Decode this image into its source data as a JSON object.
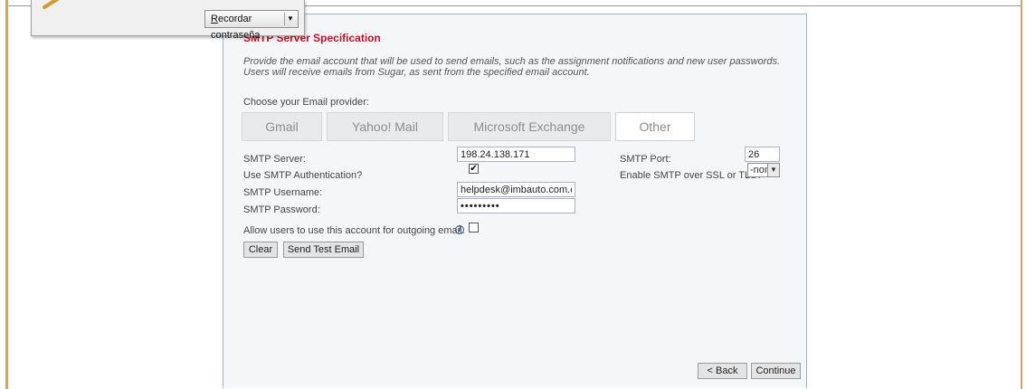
{
  "popup": {
    "remember_button": "Recordar contraseña"
  },
  "smtp": {
    "title": "SMTP Server Specification",
    "description": "Provide the email account that will be used to send emails, such as the assignment notifications and new user passwords. Users will receive emails from Sugar, as sent from the specified email account.",
    "choose_provider": "Choose your Email provider:",
    "providers": [
      {
        "label": "Gmail",
        "selected": false
      },
      {
        "label": "Yahoo! Mail",
        "selected": false
      },
      {
        "label": "Microsoft Exchange",
        "selected": false
      },
      {
        "label": "Other",
        "selected": true
      }
    ],
    "server_label": "SMTP Server:",
    "server_value": "198.24.138.171",
    "port_label": "SMTP Port:",
    "port_value": "26",
    "auth_label": "Use SMTP Authentication?",
    "auth_checked": true,
    "ssl_label": "Enable SMTP over SSL or TLS?",
    "ssl_value": "-none-",
    "username_label": "SMTP Username:",
    "username_value": "helpdesk@imbauto.com.ec",
    "password_label": "SMTP Password:",
    "password_value": "•••••••••",
    "allow_label": "Allow users to use this account for outgoing email:",
    "allow_checked": false,
    "info_icon": "info-icon",
    "clear_label": "Clear",
    "send_test_label": "Send Test Email",
    "back_label": "< Back",
    "continue_label": "Continue"
  }
}
